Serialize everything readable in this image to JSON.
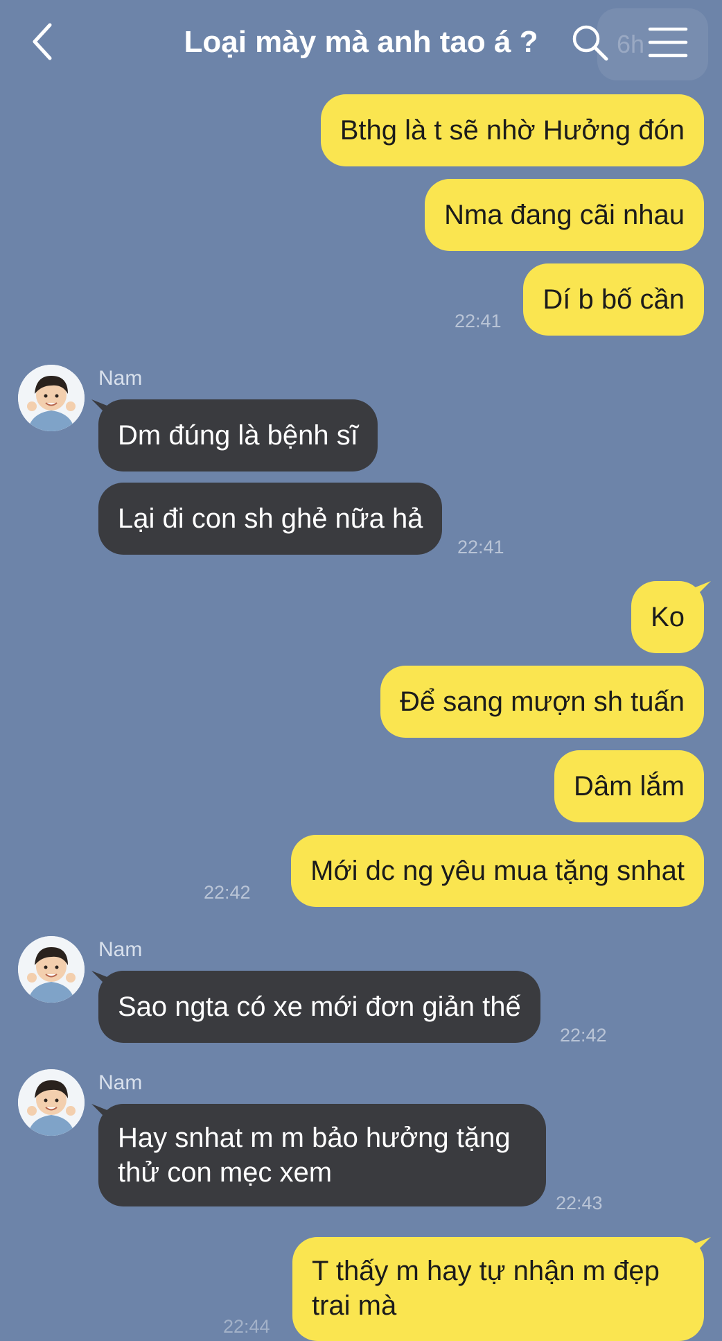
{
  "header": {
    "title": "Loại mày mà anh tao á ?",
    "ghost_text": "6h"
  },
  "messages": [
    {
      "sender": "me",
      "text": "Bthg là t sẽ nhờ Hưởng đón"
    },
    {
      "sender": "me",
      "text": "Nma đang cãi nhau"
    },
    {
      "sender": "me",
      "text": "Dí b bố cần",
      "time": "22:41"
    },
    {
      "sender": "Nam",
      "name": "Nam",
      "text": "Dm đúng là bệnh sĩ"
    },
    {
      "sender": "Nam",
      "text": "Lại đi con sh ghẻ nữa hả",
      "time": "22:41"
    },
    {
      "sender": "me",
      "text": "Ko"
    },
    {
      "sender": "me",
      "text": "Để sang mượn sh tuấn"
    },
    {
      "sender": "me",
      "text": "Dâm lắm"
    },
    {
      "sender": "me",
      "text": "Mới dc ng yêu mua tặng snhat",
      "time": "22:42"
    },
    {
      "sender": "Nam",
      "name": "Nam",
      "text": "Sao ngta có xe mới đơn giản thế",
      "time": "22:42"
    },
    {
      "sender": "Nam",
      "name": "Nam",
      "text": "Hay snhat m m bảo hưởng tặng\nthử con mẹc xem",
      "time": "22:43"
    },
    {
      "sender": "me",
      "text": "T thấy m hay tự nhận m đẹp\ntrai mà",
      "time": "22:44"
    }
  ],
  "colors": {
    "background": "#6d84a9",
    "me_bubble": "#fae550",
    "them_bubble": "#3a3b3f"
  },
  "icons": [
    "back-arrow-icon",
    "search-icon",
    "menu-icon"
  ]
}
